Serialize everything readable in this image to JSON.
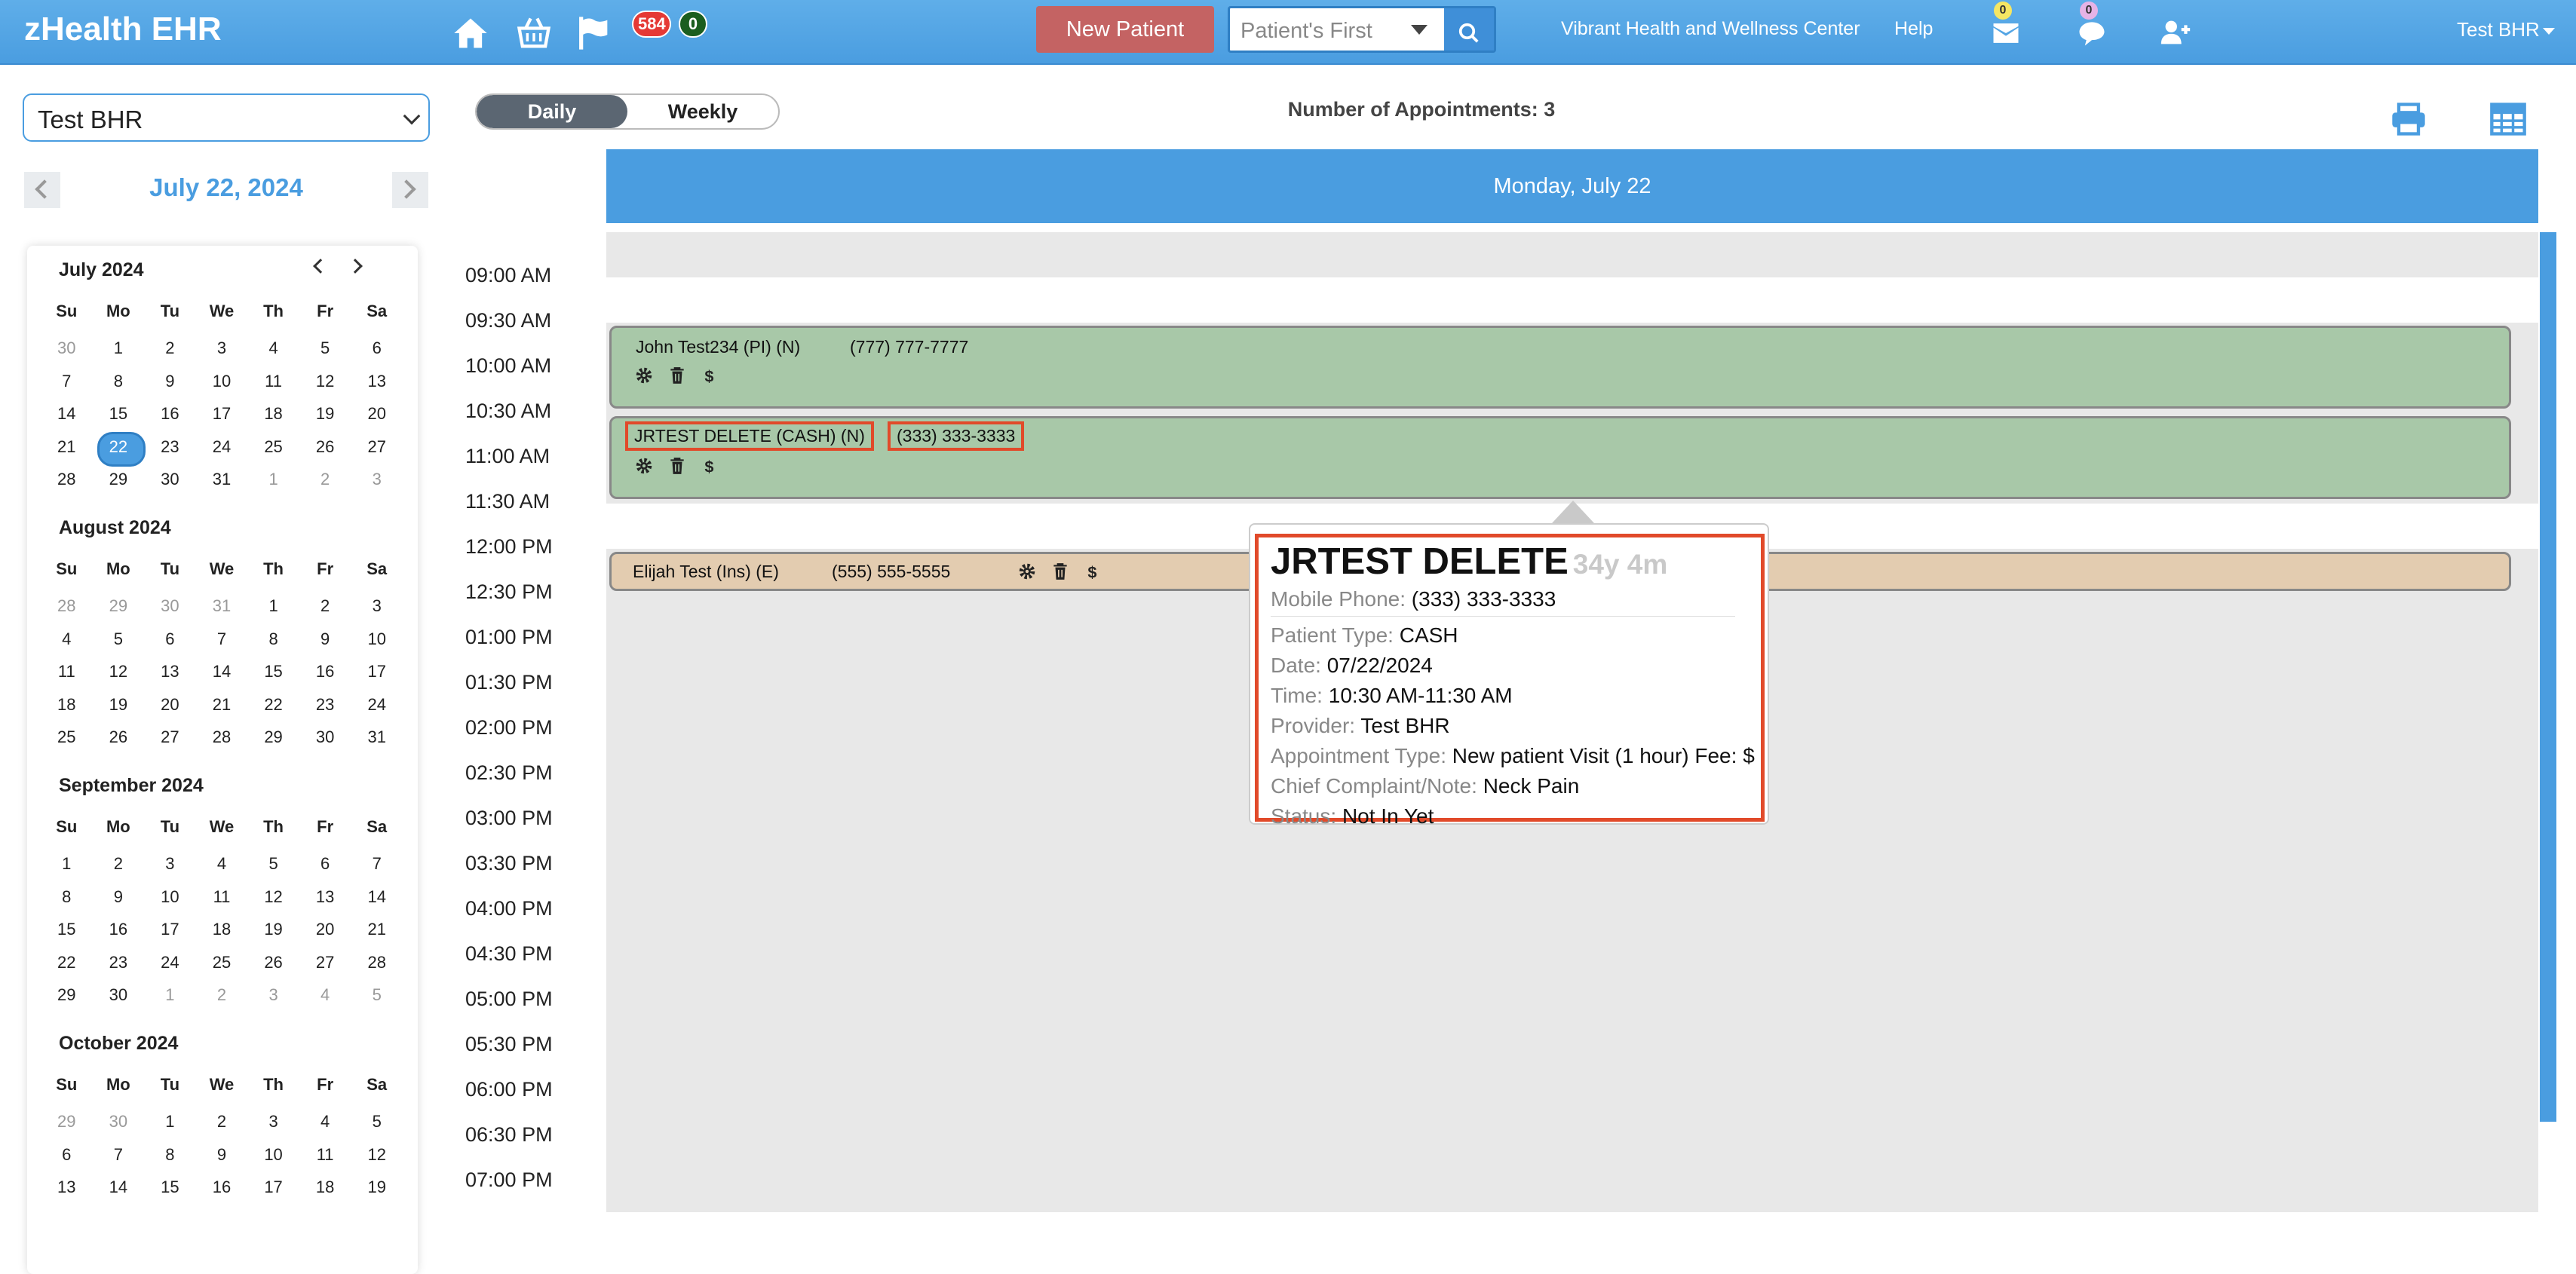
{
  "app": {
    "brand": "zHealth EHR",
    "notification_count": "584",
    "flag_count": "0",
    "new_patient_label": "New Patient",
    "search_mode": "Patient's First",
    "clinic_name": "Vibrant Health and Wellness Center",
    "help_label": "Help",
    "mail_count": "0",
    "chat_count": "0",
    "user_label": "Test BHR"
  },
  "sidebar": {
    "provider": "Test BHR",
    "current_date": "July 22, 2024",
    "dow": [
      "Su",
      "Mo",
      "Tu",
      "We",
      "Th",
      "Fr",
      "Sa"
    ],
    "months": [
      {
        "title": "July 2024",
        "days": [
          [
            "30",
            "m"
          ],
          [
            "1"
          ],
          [
            "2"
          ],
          [
            "3"
          ],
          [
            "4"
          ],
          [
            "5"
          ],
          [
            "6"
          ],
          [
            "7"
          ],
          [
            "8"
          ],
          [
            "9"
          ],
          [
            "10"
          ],
          [
            "11"
          ],
          [
            "12"
          ],
          [
            "13"
          ],
          [
            "14"
          ],
          [
            "15"
          ],
          [
            "16"
          ],
          [
            "17"
          ],
          [
            "18"
          ],
          [
            "19"
          ],
          [
            "20"
          ],
          [
            "21"
          ],
          [
            "22",
            "s"
          ],
          [
            "23"
          ],
          [
            "24"
          ],
          [
            "25"
          ],
          [
            "26"
          ],
          [
            "27"
          ],
          [
            "28"
          ],
          [
            "29"
          ],
          [
            "30"
          ],
          [
            "31"
          ],
          [
            "1",
            "m"
          ],
          [
            "2",
            "m"
          ],
          [
            "3",
            "m"
          ]
        ]
      },
      {
        "title": "August 2024",
        "days": [
          [
            "28",
            "m"
          ],
          [
            "29",
            "m"
          ],
          [
            "30",
            "m"
          ],
          [
            "31",
            "m"
          ],
          [
            "1"
          ],
          [
            "2"
          ],
          [
            "3"
          ],
          [
            "4"
          ],
          [
            "5"
          ],
          [
            "6"
          ],
          [
            "7"
          ],
          [
            "8"
          ],
          [
            "9"
          ],
          [
            "10"
          ],
          [
            "11"
          ],
          [
            "12"
          ],
          [
            "13"
          ],
          [
            "14"
          ],
          [
            "15"
          ],
          [
            "16"
          ],
          [
            "17"
          ],
          [
            "18"
          ],
          [
            "19"
          ],
          [
            "20"
          ],
          [
            "21"
          ],
          [
            "22"
          ],
          [
            "23"
          ],
          [
            "24"
          ],
          [
            "25"
          ],
          [
            "26"
          ],
          [
            "27"
          ],
          [
            "28"
          ],
          [
            "29"
          ],
          [
            "30"
          ],
          [
            "31"
          ]
        ]
      },
      {
        "title": "September 2024",
        "days": [
          [
            "1"
          ],
          [
            "2"
          ],
          [
            "3"
          ],
          [
            "4"
          ],
          [
            "5"
          ],
          [
            "6"
          ],
          [
            "7"
          ],
          [
            "8"
          ],
          [
            "9"
          ],
          [
            "10"
          ],
          [
            "11"
          ],
          [
            "12"
          ],
          [
            "13"
          ],
          [
            "14"
          ],
          [
            "15"
          ],
          [
            "16"
          ],
          [
            "17"
          ],
          [
            "18"
          ],
          [
            "19"
          ],
          [
            "20"
          ],
          [
            "21"
          ],
          [
            "22"
          ],
          [
            "23"
          ],
          [
            "24"
          ],
          [
            "25"
          ],
          [
            "26"
          ],
          [
            "27"
          ],
          [
            "28"
          ],
          [
            "29"
          ],
          [
            "30"
          ],
          [
            "1",
            "m"
          ],
          [
            "2",
            "m"
          ],
          [
            "3",
            "m"
          ],
          [
            "4",
            "m"
          ],
          [
            "5",
            "m"
          ]
        ]
      },
      {
        "title": "October 2024",
        "days": [
          [
            "29",
            "m"
          ],
          [
            "30",
            "m"
          ],
          [
            "1"
          ],
          [
            "2"
          ],
          [
            "3"
          ],
          [
            "4"
          ],
          [
            "5"
          ],
          [
            "6"
          ],
          [
            "7"
          ],
          [
            "8"
          ],
          [
            "9"
          ],
          [
            "10"
          ],
          [
            "11"
          ],
          [
            "12"
          ],
          [
            "13"
          ],
          [
            "14"
          ],
          [
            "15"
          ],
          [
            "16"
          ],
          [
            "17"
          ],
          [
            "18"
          ],
          [
            "19"
          ]
        ]
      }
    ]
  },
  "main": {
    "view_daily": "Daily",
    "view_weekly": "Weekly",
    "appointment_count": "Number of Appointments: 3",
    "day_header": "Monday, July 22",
    "times": [
      "09:00 AM",
      "09:30 AM",
      "10:00 AM",
      "10:30 AM",
      "11:00 AM",
      "11:30 AM",
      "12:00 PM",
      "12:30 PM",
      "01:00 PM",
      "01:30 PM",
      "02:00 PM",
      "02:30 PM",
      "03:00 PM",
      "03:30 PM",
      "04:00 PM",
      "04:30 PM",
      "05:00 PM",
      "05:30 PM",
      "06:00 PM",
      "06:30 PM",
      "07:00 PM"
    ],
    "appointments": [
      {
        "name": "John Test234 (PI) (N)",
        "phone": "(777) 777-7777"
      },
      {
        "name": "JRTEST DELETE (CASH) (N)",
        "phone": "(333) 333-3333"
      },
      {
        "name": "Elijah Test (Ins) (E)",
        "phone": "(555) 555-5555"
      }
    ]
  },
  "popover": {
    "name": "JRTEST DELETE",
    "age": "34y 4m",
    "rows": [
      {
        "label": "Mobile Phone:",
        "value": "(333) 333-3333"
      },
      {
        "label": "Patient Type:",
        "value": "CASH"
      },
      {
        "label": "Date:",
        "value": "07/22/2024"
      },
      {
        "label": "Time:",
        "value": "10:30 AM-11:30 AM"
      },
      {
        "label": "Provider:",
        "value": "Test BHR"
      },
      {
        "label": "Appointment Type:",
        "value": "New patient Visit (1 hour) Fee: $"
      },
      {
        "label": "Chief Complaint/Note:",
        "value": "Neck Pain"
      },
      {
        "label": "Status:",
        "value": "Not In Yet"
      }
    ]
  }
}
